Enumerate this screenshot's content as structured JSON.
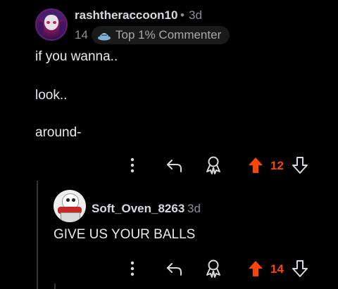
{
  "comment1": {
    "username": "rashtheraccoon10",
    "separator": "•",
    "time": "3d",
    "karma": "14",
    "badge_label": "Top 1% Commenter",
    "lines": [
      "if you wanna..",
      "look..",
      "around-"
    ],
    "vote_count": "12",
    "vote_color": "#ff4500"
  },
  "comment2": {
    "username": "Soft_Oven_8263",
    "time": "3d",
    "text": "GIVE US YOUR BALLS",
    "vote_count": "14",
    "vote_color": "#ff4500"
  },
  "icons": {
    "more": "more-vertical-icon",
    "reply": "reply-arrow-icon",
    "award": "award-icon",
    "upvote": "upvote-arrow-icon",
    "downvote": "downvote-arrow-icon"
  }
}
